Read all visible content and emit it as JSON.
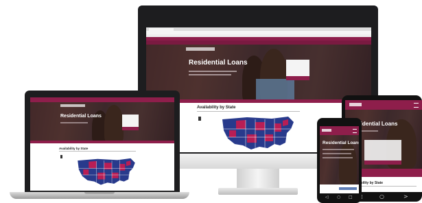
{
  "page": {
    "hero_title": "Residential Loans",
    "section_title": "Availability by State"
  },
  "colors": {
    "brand": "#8e1e4b",
    "map_blue": "#283a8c",
    "map_pink": "#b81e55"
  },
  "devices": [
    "desktop-monitor",
    "laptop",
    "tablet",
    "phone"
  ],
  "icons": {
    "phone_nav": [
      "back-icon",
      "home-icon",
      "recents-icon"
    ],
    "tablet_nav": [
      "back-icon",
      "home-icon",
      "next-icon"
    ]
  },
  "nav_glyphs": {
    "back": "◁",
    "home": "○",
    "recents": "□",
    "next": ">"
  }
}
